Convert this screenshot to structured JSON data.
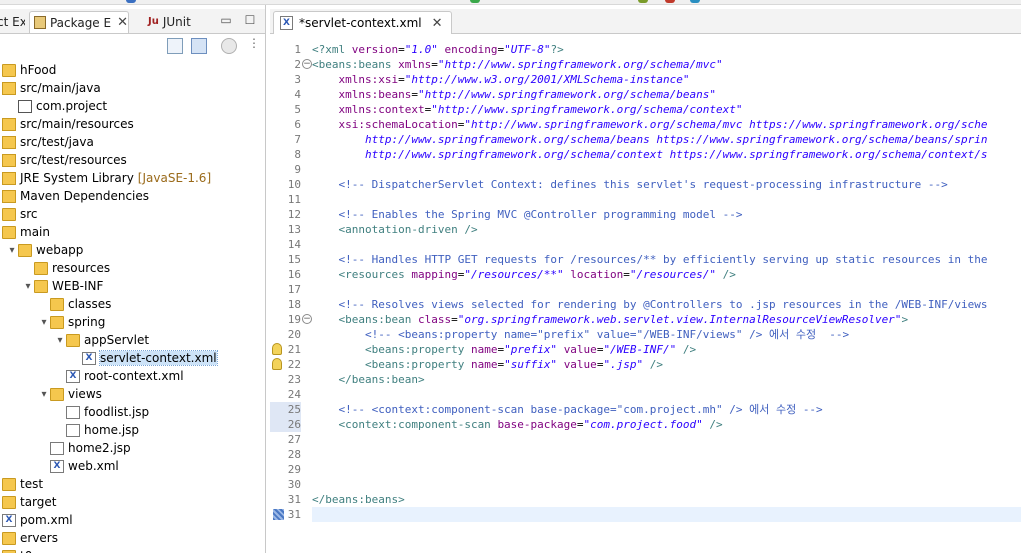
{
  "left_panel": {
    "tabs": [
      {
        "label": "ct Ex",
        "active": false
      },
      {
        "label": "Package E",
        "active": true
      },
      {
        "label": "JUnit",
        "active": false
      }
    ],
    "tree": [
      {
        "depth": 0,
        "arrow": "",
        "icon": "project-icon",
        "label": "hFood"
      },
      {
        "depth": 0,
        "arrow": "",
        "icon": "source-folder-icon",
        "label": "src/main/java"
      },
      {
        "depth": 1,
        "arrow": "",
        "icon": "package-icon",
        "label": "com.project"
      },
      {
        "depth": 0,
        "arrow": "",
        "icon": "source-folder-icon",
        "label": "src/main/resources"
      },
      {
        "depth": 0,
        "arrow": "",
        "icon": "source-folder-icon",
        "label": "src/test/java"
      },
      {
        "depth": 0,
        "arrow": "",
        "icon": "source-folder-icon",
        "label": "src/test/resources"
      },
      {
        "depth": 0,
        "arrow": "",
        "icon": "library-icon",
        "label": "JRE System Library",
        "suffix": "[JavaSE-1.6]"
      },
      {
        "depth": 0,
        "arrow": "",
        "icon": "library-icon",
        "label": "Maven Dependencies"
      },
      {
        "depth": 0,
        "arrow": "",
        "icon": "folder-icon",
        "label": "src"
      },
      {
        "depth": 0,
        "arrow": "▾",
        "icon": "folder-icon",
        "label": "main"
      },
      {
        "depth": 1,
        "arrow": "▾",
        "icon": "folder-icon",
        "label": "webapp"
      },
      {
        "depth": 2,
        "arrow": "",
        "icon": "folder-icon",
        "label": "resources"
      },
      {
        "depth": 2,
        "arrow": "▾",
        "icon": "folder-icon",
        "label": "WEB-INF"
      },
      {
        "depth": 3,
        "arrow": "",
        "icon": "folder-icon",
        "label": "classes"
      },
      {
        "depth": 3,
        "arrow": "▾",
        "icon": "folder-icon",
        "label": "spring"
      },
      {
        "depth": 4,
        "arrow": "▾",
        "icon": "folder-icon",
        "label": "appServlet"
      },
      {
        "depth": 5,
        "arrow": "",
        "icon": "xml-file-icon",
        "label": "servlet-context.xml",
        "selected": true
      },
      {
        "depth": 4,
        "arrow": "",
        "icon": "xml-file-icon",
        "label": "root-context.xml"
      },
      {
        "depth": 3,
        "arrow": "▾",
        "icon": "folder-icon",
        "label": "views"
      },
      {
        "depth": 4,
        "arrow": "",
        "icon": "file-icon",
        "label": "foodlist.jsp"
      },
      {
        "depth": 4,
        "arrow": "",
        "icon": "file-icon",
        "label": "home.jsp"
      },
      {
        "depth": 3,
        "arrow": "",
        "icon": "file-icon",
        "label": "home2.jsp"
      },
      {
        "depth": 3,
        "arrow": "",
        "icon": "xml-file-icon",
        "label": "web.xml"
      },
      {
        "depth": 0,
        "arrow": "",
        "icon": "folder-icon",
        "label": "test"
      },
      {
        "depth": 0,
        "arrow": "",
        "icon": "folder-icon",
        "label": "target"
      },
      {
        "depth": 0,
        "arrow": "",
        "icon": "xml-file-icon",
        "label": "pom.xml"
      },
      {
        "depth": 0,
        "arrow": "",
        "icon": "server-icon",
        "label": "ervers"
      },
      {
        "depth": 0,
        "arrow": "",
        "icon": "folder-icon",
        "label": "t0"
      }
    ]
  },
  "editor": {
    "tab_label": "*servlet-context.xml",
    "lines": [
      {
        "n": "1",
        "tokens": [
          [
            "pi",
            "<?xml "
          ],
          [
            "attr",
            "version"
          ],
          [
            "text",
            "="
          ],
          [
            "val",
            "\"1.0\""
          ],
          [
            "text",
            " "
          ],
          [
            "attr",
            "encoding"
          ],
          [
            "text",
            "="
          ],
          [
            "val",
            "\"UTF-8\""
          ],
          [
            "pi",
            "?>"
          ]
        ]
      },
      {
        "n": "2",
        "fold": true,
        "tokens": [
          [
            "tag",
            "<beans:beans "
          ],
          [
            "attr",
            "xmlns"
          ],
          [
            "text",
            "="
          ],
          [
            "val",
            "\"http://www.springframework.org/schema/mvc\""
          ]
        ]
      },
      {
        "n": "3",
        "tokens": [
          [
            "text",
            "    "
          ],
          [
            "attr",
            "xmlns:xsi"
          ],
          [
            "text",
            "="
          ],
          [
            "val",
            "\"http://www.w3.org/2001/XMLSchema-instance\""
          ]
        ]
      },
      {
        "n": "4",
        "tokens": [
          [
            "text",
            "    "
          ],
          [
            "attr",
            "xmlns:beans"
          ],
          [
            "text",
            "="
          ],
          [
            "val",
            "\"http://www.springframework.org/schema/beans\""
          ]
        ]
      },
      {
        "n": "5",
        "tokens": [
          [
            "text",
            "    "
          ],
          [
            "attr",
            "xmlns:context"
          ],
          [
            "text",
            "="
          ],
          [
            "val",
            "\"http://www.springframework.org/schema/context\""
          ]
        ]
      },
      {
        "n": "6",
        "tokens": [
          [
            "text",
            "    "
          ],
          [
            "attr",
            "xsi:schemaLocation"
          ],
          [
            "text",
            "="
          ],
          [
            "val",
            "\"http://www.springframework.org/schema/mvc https://www.springframework.org/sche"
          ]
        ]
      },
      {
        "n": "7",
        "tokens": [
          [
            "val",
            "        http://www.springframework.org/schema/beans https://www.springframework.org/schema/beans/sprin"
          ]
        ]
      },
      {
        "n": "8",
        "tokens": [
          [
            "val",
            "        http://www.springframework.org/schema/context https://www.springframework.org/schema/context/s"
          ]
        ]
      },
      {
        "n": "9",
        "tokens": []
      },
      {
        "n": "10",
        "tokens": [
          [
            "comment",
            "    <!-- DispatcherServlet Context: defines this servlet's request-processing infrastructure -->"
          ]
        ]
      },
      {
        "n": "11",
        "tokens": []
      },
      {
        "n": "12",
        "tokens": [
          [
            "comment",
            "    <!-- Enables the Spring MVC @Controller programming model -->"
          ]
        ]
      },
      {
        "n": "13",
        "tokens": [
          [
            "tag",
            "    <annotation-driven />"
          ]
        ]
      },
      {
        "n": "14",
        "tokens": []
      },
      {
        "n": "15",
        "tokens": [
          [
            "comment",
            "    <!-- Handles HTTP GET requests for /resources/** by efficiently serving up static resources in the"
          ]
        ]
      },
      {
        "n": "16",
        "tokens": [
          [
            "tag",
            "    <resources "
          ],
          [
            "attr",
            "mapping"
          ],
          [
            "text",
            "="
          ],
          [
            "val",
            "\"/resources/**\""
          ],
          [
            "text",
            " "
          ],
          [
            "attr",
            "location"
          ],
          [
            "text",
            "="
          ],
          [
            "val",
            "\"/resources/\""
          ],
          [
            "tag",
            " />"
          ]
        ]
      },
      {
        "n": "17",
        "tokens": []
      },
      {
        "n": "18",
        "tokens": [
          [
            "comment",
            "    <!-- Resolves views selected for rendering by @Controllers to .jsp resources in the /WEB-INF/views"
          ]
        ]
      },
      {
        "n": "19",
        "fold": true,
        "tokens": [
          [
            "tag",
            "    <beans:bean "
          ],
          [
            "attr",
            "class"
          ],
          [
            "text",
            "="
          ],
          [
            "val",
            "\"org.springframework.web.servlet.view.InternalResourceViewResolver\""
          ],
          [
            "tag",
            ">"
          ]
        ]
      },
      {
        "n": "20",
        "tokens": [
          [
            "comment",
            "        <!-- <beans:property name=\"prefix\" value=\"/WEB-INF/views\" /> 에서 수정  -->"
          ]
        ]
      },
      {
        "n": "21",
        "warn": true,
        "tokens": [
          [
            "tag",
            "        <beans:property "
          ],
          [
            "attr",
            "name"
          ],
          [
            "text",
            "="
          ],
          [
            "val",
            "\"prefix\""
          ],
          [
            "text",
            " "
          ],
          [
            "attr",
            "value"
          ],
          [
            "text",
            "="
          ],
          [
            "val",
            "\"/WEB-INF/\""
          ],
          [
            "tag",
            " />"
          ]
        ]
      },
      {
        "n": "22",
        "warn": true,
        "tokens": [
          [
            "tag",
            "        <beans:property "
          ],
          [
            "attr",
            "name"
          ],
          [
            "text",
            "="
          ],
          [
            "val",
            "\"suffix\""
          ],
          [
            "text",
            " "
          ],
          [
            "attr",
            "value"
          ],
          [
            "text",
            "="
          ],
          [
            "val",
            "\".jsp\""
          ],
          [
            "tag",
            " />"
          ]
        ]
      },
      {
        "n": "23",
        "tokens": [
          [
            "tag",
            "    </beans:bean>"
          ]
        ]
      },
      {
        "n": "24",
        "tokens": []
      },
      {
        "n": "25",
        "changed": true,
        "tokens": [
          [
            "comment",
            "    <!-- <context:component-scan base-package=\"com.project.mh\" /> 에서 수정 -->"
          ]
        ]
      },
      {
        "n": "26",
        "changed": true,
        "tokens": [
          [
            "tag",
            "    <context:component-scan "
          ],
          [
            "attr",
            "base-package"
          ],
          [
            "text",
            "="
          ],
          [
            "val",
            "\"com.project.food\""
          ],
          [
            "tag",
            " />"
          ]
        ]
      },
      {
        "n": "27",
        "tokens": []
      },
      {
        "n": "28",
        "tokens": []
      },
      {
        "n": "29",
        "tokens": []
      },
      {
        "n": "30",
        "tokens": []
      },
      {
        "n": "31",
        "tokens": [
          [
            "tag",
            "</beans:beans>"
          ]
        ]
      },
      {
        "n": "31",
        "current": true,
        "tokens": []
      }
    ]
  },
  "colors": {
    "accent": "#cde3f8",
    "current_line": "#e8f2fe",
    "tag": "#3f7f7f",
    "attr": "#7f007f",
    "value": "#2a00ff",
    "comment": "#3f5fbf"
  }
}
